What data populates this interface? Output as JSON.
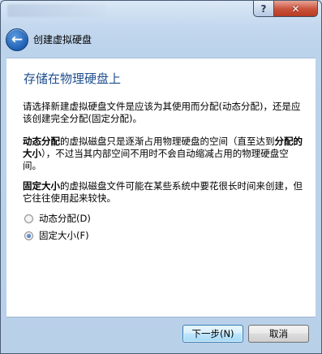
{
  "titlebar": {
    "help_label": "?",
    "close_label": "✕"
  },
  "header": {
    "back_glyph": "←",
    "title": "创建虚拟硬盘"
  },
  "page": {
    "heading": "存储在物理硬盘上",
    "intro": "请选择新建虚拟硬盘文件是应该为其使用而分配(动态分配)，还是应该创建完全分配(固定分配)。",
    "dynamic_term": "动态分配",
    "dynamic_text_a": "的虚拟磁盘只是逐渐占用物理硬盘的空间（直至达到",
    "dynamic_term_2": "分配的大小",
    "dynamic_text_b": "），不过当其内部空间不用时不会自动缩减占用的物理硬盘空间。",
    "fixed_term": "固定大小",
    "fixed_text": "的虚拟磁盘文件可能在某些系统中要花很长时间来创建，但它往往使用起来较快。"
  },
  "options": [
    {
      "label": "动态分配(D)",
      "checked": false
    },
    {
      "label": "固定大小(F)",
      "checked": true
    }
  ],
  "buttons": {
    "next": "下一步(N)",
    "cancel": "取消"
  },
  "colors": {
    "heading": "#1f4e8e",
    "window_chrome": "#c4d8ee",
    "close_button": "#c9513a"
  }
}
